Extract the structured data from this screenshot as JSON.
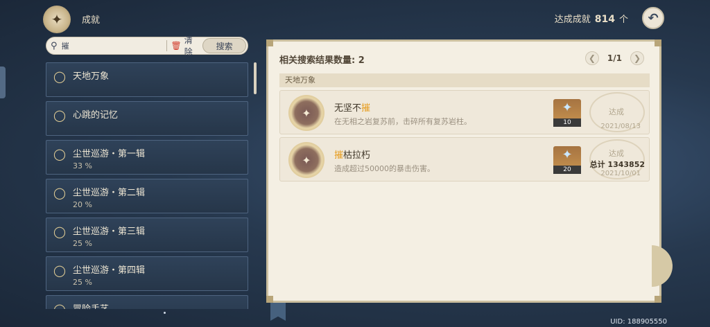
{
  "header": {
    "crest_icon": "achievement-crest-icon",
    "title": "成就",
    "total_label": "达成成就",
    "total_count": "814",
    "total_unit": "个",
    "back_icon": "back-arrow-icon"
  },
  "search": {
    "value": "摧",
    "clear_label": "清除",
    "search_label": "搜索"
  },
  "categories": [
    {
      "name": "天地万象",
      "percent": ""
    },
    {
      "name": "心跳的记忆",
      "percent": ""
    },
    {
      "name": "尘世巡游・第一辑",
      "percent": "33 %"
    },
    {
      "name": "尘世巡游・第二辑",
      "percent": "20 %"
    },
    {
      "name": "尘世巡游・第三辑",
      "percent": "25 %"
    },
    {
      "name": "尘世巡游・第四辑",
      "percent": "25 %"
    },
    {
      "name": "冒险手艺",
      "percent": ""
    }
  ],
  "results": {
    "count_label": "相关搜索结果数量: 2",
    "page": "1/1",
    "group": "天地万象",
    "items": [
      {
        "title_prefix": "无坚不",
        "title_highlight": "摧",
        "title_suffix": "",
        "desc": "在无相之岩复苏前，击碎所有复苏岩柱。",
        "reward": "10",
        "status": "达成",
        "total": "",
        "date": "2021/08/13"
      },
      {
        "title_prefix": "",
        "title_highlight": "摧",
        "title_suffix": "枯拉朽",
        "desc": "造成超过50000的暴击伤害。",
        "reward": "20",
        "status": "达成",
        "total": "总计 1343852",
        "date": "2021/10/01"
      }
    ]
  },
  "footer": {
    "uid": "UID: 188905550"
  },
  "colors": {
    "highlight": "#e69a19",
    "panel_bg": "#f4efe3",
    "list_bg": "#2f4259"
  }
}
